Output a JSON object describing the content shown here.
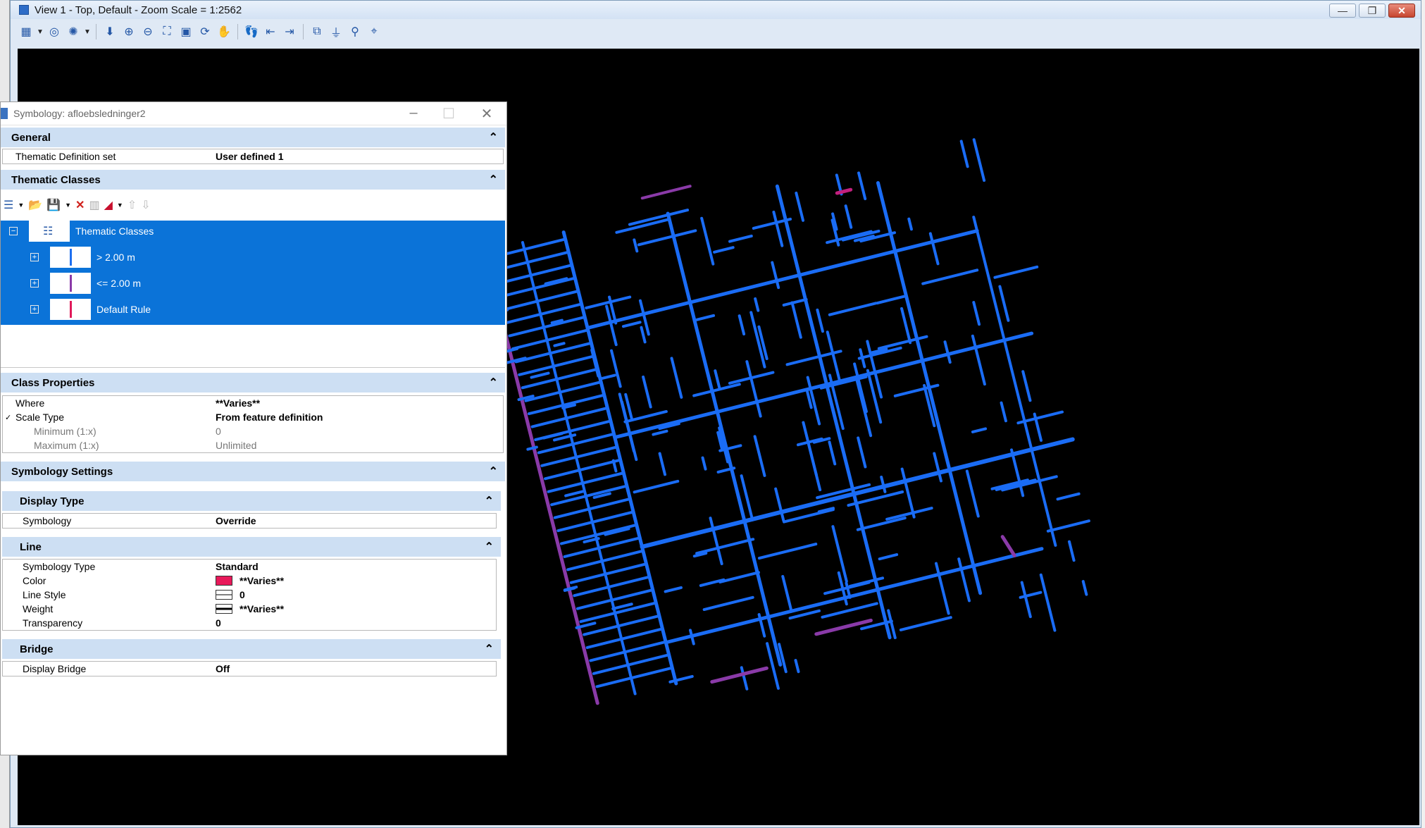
{
  "window": {
    "title": "View 1 - Top, Default - Zoom Scale = 1:2562",
    "controls": [
      "—",
      "❐",
      "✕"
    ]
  },
  "view_toolbar": {
    "icons": [
      "view-attributes-icon",
      "view-display-mode-icon",
      "brightness-icon",
      "update-view-icon",
      "zoom-in-icon",
      "zoom-out-icon",
      "window-area-icon",
      "fit-view-icon",
      "rotate-view-icon",
      "pan-view-icon",
      "walk-icon",
      "previous-view-icon",
      "next-view-icon",
      "copy-view-icon",
      "clip-volume-icon",
      "clip-mask-icon",
      "camera-icon"
    ]
  },
  "dialog": {
    "title": "Symbology: afloebsledninger2",
    "general": {
      "header": "General",
      "rows": [
        {
          "key": "Thematic Definition set",
          "value": "User defined 1"
        }
      ]
    },
    "thematic_classes": {
      "header": "Thematic Classes",
      "root": "Thematic Classes",
      "items": [
        {
          "label": "> 2.00 m",
          "color": "#1e6ff0"
        },
        {
          "label": "<= 2.00 m",
          "color": "#8a3aa8"
        },
        {
          "label": "Default Rule",
          "color": "#e0195a"
        }
      ]
    },
    "class_properties": {
      "header": "Class Properties",
      "rows": [
        {
          "key": "Where",
          "value": "**Varies**"
        },
        {
          "key": "Scale Type",
          "value": "From feature definition",
          "check": "✓"
        },
        {
          "key": "Minimum (1:x)",
          "value": "0"
        },
        {
          "key": "Maximum (1:x)",
          "value": "Unlimited"
        }
      ]
    },
    "symbology_settings": {
      "header": "Symbology Settings"
    },
    "display_type": {
      "header": "Display Type",
      "rows": [
        {
          "key": "Symbology",
          "value": "Override"
        }
      ]
    },
    "line": {
      "header": "Line",
      "rows": [
        {
          "key": "Symbology Type",
          "value": "Standard"
        },
        {
          "key": "Color",
          "value": "**Varies**",
          "swatch": "#e8195a"
        },
        {
          "key": "Line Style",
          "value": "0"
        },
        {
          "key": "Weight",
          "value": "**Varies**"
        },
        {
          "key": "Transparency",
          "value": "0"
        }
      ]
    },
    "bridge": {
      "header": "Bridge",
      "rows": [
        {
          "key": "Display Bridge",
          "value": "Off"
        }
      ]
    }
  },
  "network_colors": {
    "main": "#1a6cf5",
    "secondary": "#8a3aa8",
    "accent": "#c2207e"
  }
}
